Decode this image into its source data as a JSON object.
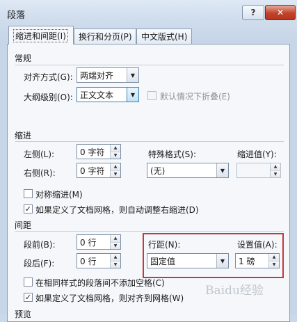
{
  "window": {
    "title": "段落",
    "help_glyph": "?",
    "close_glyph": "✕"
  },
  "tabs": [
    {
      "label": "缩进和间距(I)",
      "active": true
    },
    {
      "label": "换行和分页(P)",
      "active": false
    },
    {
      "label": "中文版式(H)",
      "active": false
    }
  ],
  "general": {
    "header": "常规",
    "alignment": {
      "label": "对齐方式(G):",
      "value": "两端对齐"
    },
    "outline_level": {
      "label": "大纲级别(O):",
      "value": "正文文本"
    },
    "collapse_default": {
      "label": "默认情况下折叠(E)",
      "checked": false,
      "enabled": false
    }
  },
  "indent": {
    "header": "缩进",
    "left": {
      "label": "左侧(L):",
      "value": "0 字符"
    },
    "right": {
      "label": "右侧(R):",
      "value": "0 字符"
    },
    "special": {
      "label": "特殊格式(S):",
      "value": "(无)"
    },
    "indent_by": {
      "label": "缩进值(Y):",
      "value": ""
    },
    "mirror": {
      "label": "对称缩进(M)",
      "checked": false
    },
    "auto_adjust": {
      "label": "如果定义了文档网格，则自动调整右缩进(D)",
      "checked": true
    }
  },
  "spacing": {
    "header": "间距",
    "before": {
      "label": "段前(B):",
      "value": "0 行"
    },
    "after": {
      "label": "段后(F):",
      "value": "0 行"
    },
    "line_spacing": {
      "label": "行距(N):",
      "value": "固定值"
    },
    "at": {
      "label": "设置值(A):",
      "value": "1 磅"
    },
    "no_space_same_style": {
      "label": "在相同样式的段落间不添加空格(C)",
      "checked": false
    },
    "snap_to_grid": {
      "label": "如果定义了文档网格，则对齐到网格(W)",
      "checked": true
    }
  },
  "preview": {
    "header": "预览"
  },
  "watermark": {
    "text": "Baidu经验"
  },
  "colors": {
    "highlight": "#c0393b",
    "panel": "#f5f7fa",
    "chrome": "#cfdcec"
  }
}
